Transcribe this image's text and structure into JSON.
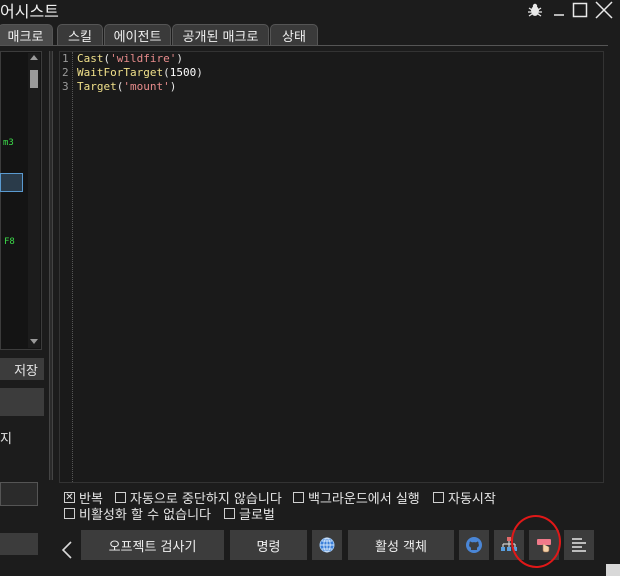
{
  "window": {
    "title": "어시스트"
  },
  "tabs": [
    {
      "label": "매크로",
      "active": true
    },
    {
      "label": "스킬",
      "active": false
    },
    {
      "label": "에이전트",
      "active": false
    },
    {
      "label": "공개된 매크로",
      "active": false
    },
    {
      "label": "상태",
      "active": false
    }
  ],
  "left_panel": {
    "item_fragment_1": "m3",
    "item_fragment_2": "F8",
    "save_label": "저장",
    "fragment_ji": "지"
  },
  "editor": {
    "line_numbers": [
      "1",
      "2",
      "3"
    ],
    "lines": [
      {
        "fn": "Cast",
        "open": "(",
        "arg": "'wildfire'",
        "close": ")"
      },
      {
        "fn": "WaitForTarget",
        "open": "(",
        "arg": "1500",
        "close": ")"
      },
      {
        "fn": "Target",
        "open": "(",
        "arg": "'mount'",
        "close": ")"
      }
    ]
  },
  "options": {
    "loop": {
      "label": "반복",
      "checked": true
    },
    "no_auto_interrupt": {
      "label": "자동으로 중단하지 않습니다",
      "checked": false
    },
    "run_in_background": {
      "label": "백그라운드에서 실행",
      "checked": false
    },
    "autostart": {
      "label": "자동시작",
      "checked": false
    },
    "cannot_disable": {
      "label": "비활성화 할 수 없습니다",
      "checked": false
    },
    "global": {
      "label": "글로벌",
      "checked": false
    }
  },
  "toolbar": {
    "object_inspector": "오프젝트 검사기",
    "commands": "명령",
    "active_objects": "활성 객체"
  },
  "colors": {
    "background": "#1c1c1c",
    "button": "#3c3c3c",
    "function": "#f0e08a",
    "string": "#e88c8c",
    "annotation_circle": "#e01818"
  }
}
